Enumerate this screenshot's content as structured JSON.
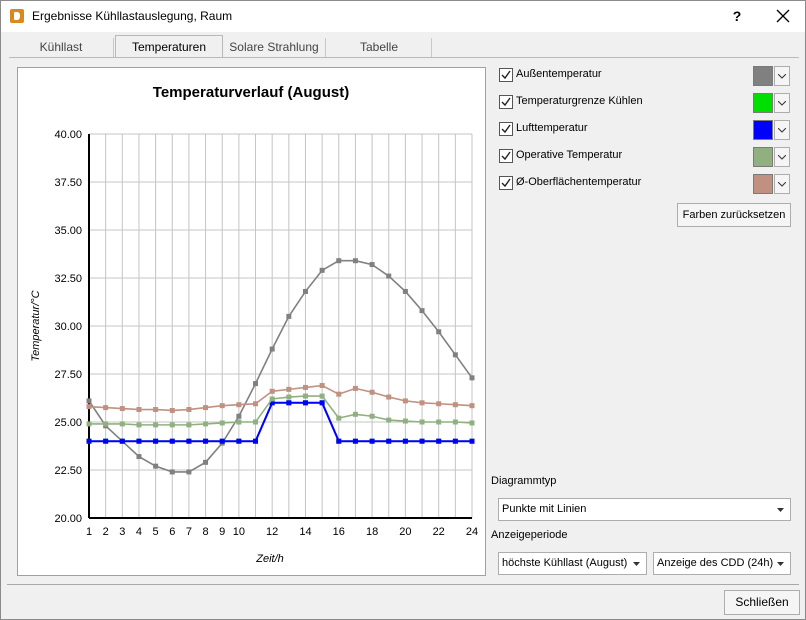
{
  "window": {
    "title": "Ergebnisse Kühllastauslegung, Raum",
    "help": "?"
  },
  "tabs": [
    "Kühllast",
    "Temperaturen",
    "Solare Strahlung",
    "Tabelle"
  ],
  "active_tab": "Temperaturen",
  "legend": [
    {
      "label": "Außentemperatur",
      "checked": true,
      "color": "#808080"
    },
    {
      "label": "Temperaturgrenze Kühlen",
      "checked": true,
      "color": "#00e000"
    },
    {
      "label": "Lufttemperatur",
      "checked": true,
      "color": "#0000ff"
    },
    {
      "label": "Operative Temperatur",
      "checked": true,
      "color": "#90b080"
    },
    {
      "label": "Ø-Oberflächentemperatur",
      "checked": true,
      "color": "#c09080"
    }
  ],
  "reset_colors_label": "Farben zurücksetzen",
  "diagram_type": {
    "label": "Diagrammtyp",
    "value": "Punkte mit Linien"
  },
  "display_period": {
    "label": "Anzeigeperiode",
    "value1": "höchste Kühllast (August)",
    "value2": "Anzeige des CDD (24h)"
  },
  "close_label": "Schließen",
  "chart_data": {
    "type": "line",
    "title": "Temperaturverlauf (August)",
    "xlabel": "Zeit/h",
    "ylabel": "Temperatur/°C",
    "ylim": [
      20,
      40
    ],
    "y_ticks": [
      "20.00",
      "22.50",
      "25.00",
      "27.50",
      "30.00",
      "32.50",
      "35.00",
      "37.50",
      "40.00"
    ],
    "x": [
      1,
      2,
      3,
      4,
      5,
      6,
      7,
      8,
      9,
      10,
      11,
      12,
      13,
      14,
      15,
      16,
      17,
      18,
      19,
      20,
      21,
      22,
      23,
      24
    ],
    "x_tick_labels": [
      "1",
      "2",
      "3",
      "4",
      "5",
      "6",
      "7",
      "8",
      "9",
      "10",
      "12",
      "14",
      "16",
      "18",
      "20",
      "22",
      "24"
    ],
    "grid": true,
    "series": [
      {
        "name": "Außentemperatur",
        "color": "#808080",
        "values": [
          26.1,
          24.8,
          24.0,
          23.2,
          22.7,
          22.4,
          22.4,
          22.9,
          23.9,
          25.3,
          27.0,
          28.8,
          30.5,
          31.8,
          32.9,
          33.4,
          33.4,
          33.2,
          32.6,
          31.8,
          30.8,
          29.7,
          28.5,
          27.3
        ]
      },
      {
        "name": "Temperaturgrenze Kühlen",
        "color": "#00e000",
        "values": [
          24.0,
          24.0,
          24.0,
          24.0,
          24.0,
          24.0,
          24.0,
          24.0,
          24.0,
          24.0,
          24.0,
          26.0,
          26.0,
          26.0,
          26.0,
          24.0,
          24.0,
          24.0,
          24.0,
          24.0,
          24.0,
          24.0,
          24.0,
          24.0
        ]
      },
      {
        "name": "Lufttemperatur",
        "color": "#0000ff",
        "values": [
          24.0,
          24.0,
          24.0,
          24.0,
          24.0,
          24.0,
          24.0,
          24.0,
          24.0,
          24.0,
          24.0,
          26.0,
          26.0,
          26.0,
          26.0,
          24.0,
          24.0,
          24.0,
          24.0,
          24.0,
          24.0,
          24.0,
          24.0,
          24.0
        ]
      },
      {
        "name": "Operative Temperatur",
        "color": "#90b080",
        "values": [
          24.9,
          24.9,
          24.9,
          24.85,
          24.85,
          24.85,
          24.85,
          24.9,
          24.95,
          25.0,
          25.0,
          26.2,
          26.3,
          26.35,
          26.35,
          25.2,
          25.4,
          25.3,
          25.1,
          25.05,
          25.0,
          25.0,
          25.0,
          24.95
        ]
      },
      {
        "name": "Ø-Oberflächentemperatur",
        "color": "#c09080",
        "values": [
          25.8,
          25.75,
          25.7,
          25.65,
          25.65,
          25.6,
          25.65,
          25.75,
          25.85,
          25.9,
          25.95,
          26.6,
          26.7,
          26.8,
          26.9,
          26.45,
          26.75,
          26.55,
          26.3,
          26.1,
          26.0,
          25.95,
          25.9,
          25.85
        ]
      }
    ]
  }
}
